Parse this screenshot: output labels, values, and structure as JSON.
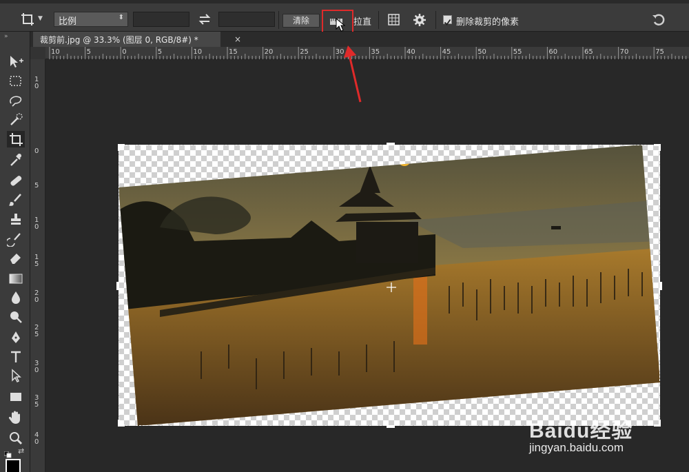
{
  "options_bar": {
    "ratio_select": "比例",
    "clear_button": "清除",
    "straighten_label": "拉直",
    "delete_pixels_label": "删除裁剪的像素",
    "delete_pixels_checked": true,
    "icons": [
      "crop-tool-icon",
      "swap-icon",
      "straighten-icon",
      "grid-overlay-icon",
      "gear-icon",
      "reset-icon"
    ]
  },
  "tab": {
    "title": "裁剪前.jpg @ 33.3% (图层 0, RGB/8#) *",
    "close": "×"
  },
  "ruler_h": [
    "10",
    "5",
    "0",
    "5",
    "10",
    "15",
    "20",
    "25",
    "30",
    "35",
    "40",
    "45",
    "50",
    "55",
    "60",
    "65",
    "70",
    "75"
  ],
  "ruler_v": [
    "1",
    "0",
    "0",
    "5",
    "1",
    "0",
    "1",
    "5",
    "2",
    "0",
    "2",
    "5",
    "3",
    "0",
    "3",
    "5",
    "4",
    "0"
  ],
  "toolbar": [
    "move-tool-icon",
    "marquee-tool-icon",
    "lasso-tool-icon",
    "quick-select-tool-icon",
    "crop-tool-icon",
    "eyedropper-tool-icon",
    "healing-brush-icon",
    "brush-tool-icon",
    "clone-stamp-icon",
    "history-brush-icon",
    "eraser-tool-icon",
    "gradient-tool-icon",
    "blur-tool-icon",
    "dodge-tool-icon",
    "pen-tool-icon",
    "type-tool-icon",
    "path-select-icon",
    "rectangle-tool-icon",
    "hand-tool-icon",
    "zoom-tool-icon"
  ],
  "colors": {
    "highlight": "#e02a2a",
    "arrow": "#e02a2a",
    "app_bg": "#282828",
    "panel_bg": "#3b3b3b"
  },
  "watermark": {
    "brand": "Baidu经验",
    "url": "jingyan.baidu.com"
  }
}
